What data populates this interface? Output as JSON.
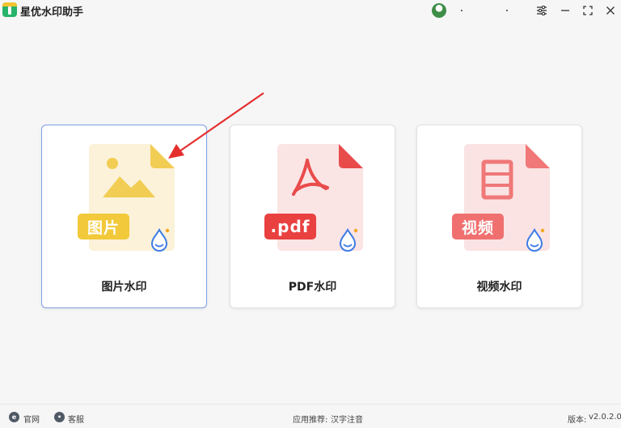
{
  "app": {
    "title": "星优水印助手"
  },
  "window_controls": {
    "settings_icon": "sliders-icon",
    "minimize": "—",
    "maximize": "⛶",
    "close": "✕"
  },
  "cards": [
    {
      "label": "图片水印",
      "badge": "图片",
      "color": "#f2cd53",
      "doc_bg": "#fbf2d9"
    },
    {
      "label": "PDF水印",
      "badge": ".pdf",
      "color": "#e94b4b",
      "doc_bg": "#fbe4e4"
    },
    {
      "label": "视频水印",
      "badge": "视频",
      "color": "#f07878",
      "doc_bg": "#fbe3e3"
    }
  ],
  "footer": {
    "website": "官网",
    "support": "客服",
    "recommend_label": "应用推荐:",
    "recommend_app": "汉字注音",
    "version_label": "版本:",
    "version": "v2.0.2.0"
  }
}
